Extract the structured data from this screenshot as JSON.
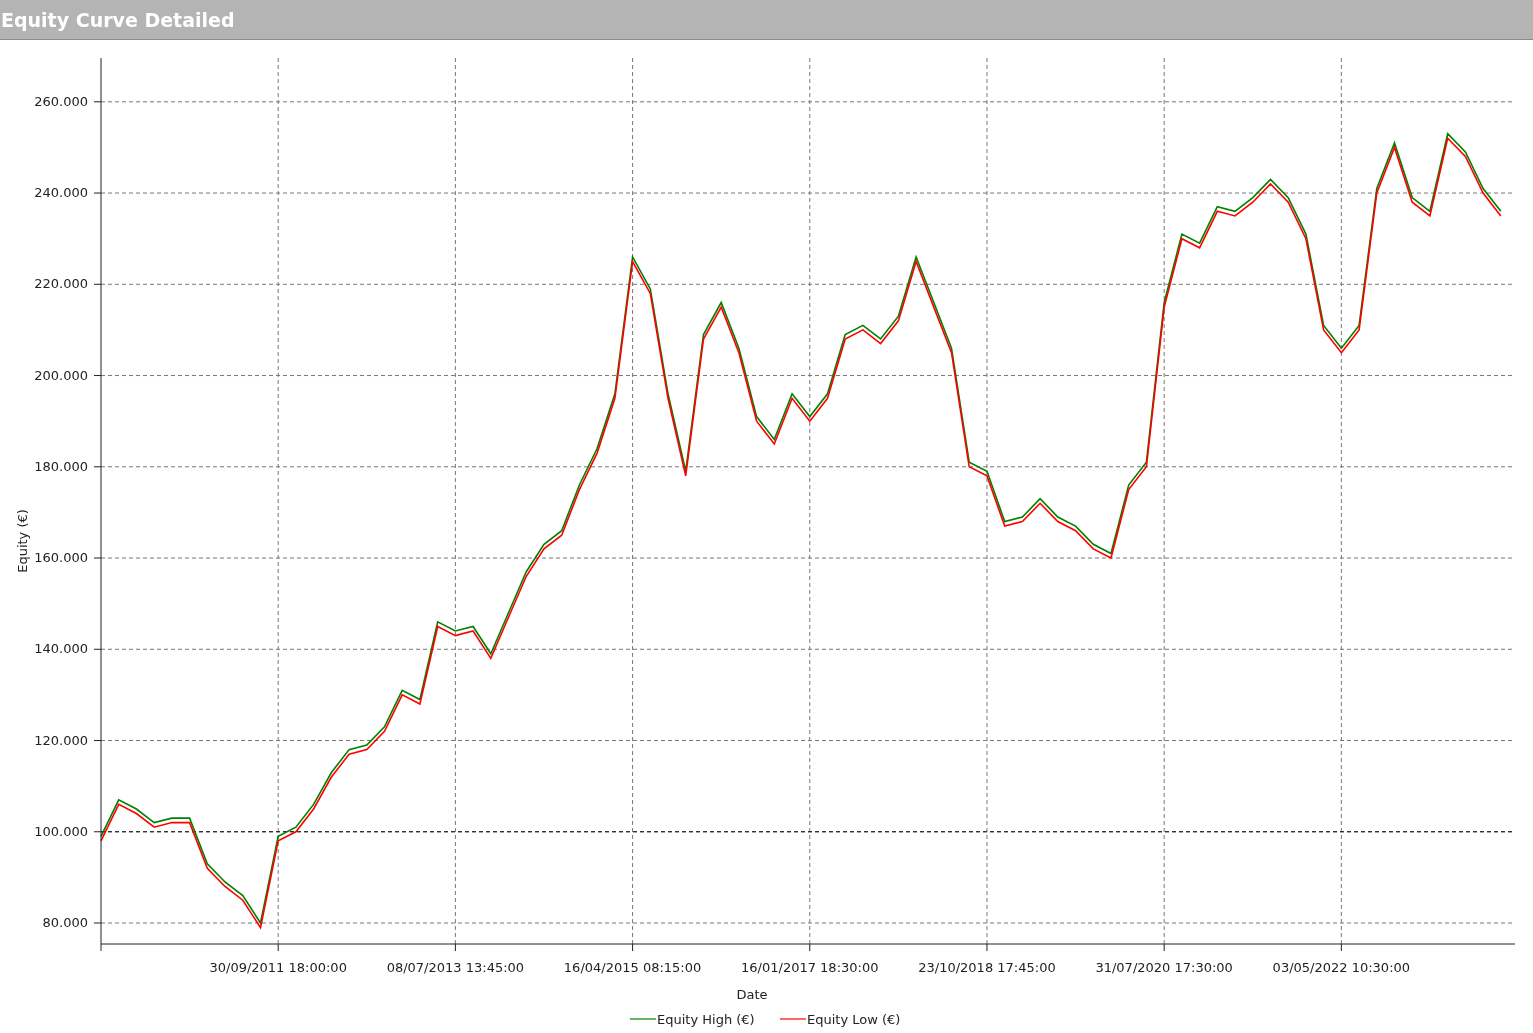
{
  "panel": {
    "title": "Equity Curve Detailed"
  },
  "chart": {
    "chart_data": {
      "type": "line",
      "xlabel": "Date",
      "ylabel": "Equity (€)",
      "categories": [
        null,
        null,
        null,
        null,
        null,
        null,
        null,
        null,
        null,
        null,
        "30/09/2011 18:00:00",
        null,
        null,
        null,
        null,
        null,
        null,
        null,
        null,
        null,
        "08/07/2013 13:45:00",
        null,
        null,
        null,
        null,
        null,
        null,
        null,
        null,
        null,
        "16/04/2015 08:15:00",
        null,
        null,
        null,
        null,
        null,
        null,
        null,
        null,
        null,
        "16/01/2017 18:30:00",
        null,
        null,
        null,
        null,
        null,
        null,
        null,
        null,
        null,
        "23/10/2018 17:45:00",
        null,
        null,
        null,
        null,
        null,
        null,
        null,
        null,
        null,
        "31/07/2020 17:30:00",
        null,
        null,
        null,
        null,
        null,
        null,
        null,
        null,
        null,
        "03/05/2022 10:30:00",
        null,
        null,
        null,
        null,
        null,
        null,
        null,
        null,
        null
      ],
      "series": [
        {
          "name": "Equity High (€)",
          "color": "#008000",
          "values": [
            99000,
            107000,
            105000,
            102000,
            103000,
            103000,
            93000,
            89000,
            86000,
            80000,
            99000,
            101000,
            106000,
            113000,
            118000,
            119000,
            123000,
            131000,
            129000,
            146000,
            144000,
            145000,
            139000,
            148000,
            157000,
            163000,
            166000,
            176000,
            184000,
            196000,
            226000,
            219000,
            196000,
            179000,
            209000,
            216000,
            206000,
            191000,
            186000,
            196000,
            191000,
            196000,
            209000,
            211000,
            208000,
            213000,
            226000,
            216000,
            206000,
            181000,
            179000,
            168000,
            169000,
            173000,
            169000,
            167000,
            163000,
            161000,
            176000,
            181000,
            216000,
            231000,
            229000,
            237000,
            236000,
            239000,
            243000,
            239000,
            231000,
            211000,
            206000,
            211000,
            241000,
            251000,
            239000,
            236000,
            253000,
            249000,
            241000,
            236000
          ]
        },
        {
          "name": "Equity Low (€)",
          "color": "#ff0000",
          "values": [
            98000,
            106000,
            104000,
            101000,
            102000,
            102000,
            92000,
            88000,
            85000,
            79000,
            98000,
            100000,
            105000,
            112000,
            117000,
            118000,
            122000,
            130000,
            128000,
            145000,
            143000,
            144000,
            138000,
            147000,
            156000,
            162000,
            165000,
            175000,
            183000,
            195000,
            225000,
            218000,
            195000,
            178000,
            208000,
            215000,
            205000,
            190000,
            185000,
            195000,
            190000,
            195000,
            208000,
            210000,
            207000,
            212000,
            225000,
            215000,
            205000,
            180000,
            178000,
            167000,
            168000,
            172000,
            168000,
            166000,
            162000,
            160000,
            175000,
            180000,
            215000,
            230000,
            228000,
            236000,
            235000,
            238000,
            242000,
            238000,
            230000,
            210000,
            205000,
            210000,
            240000,
            250000,
            238000,
            235000,
            252000,
            248000,
            240000,
            235000
          ]
        }
      ],
      "ylim": [
        75400,
        269600
      ],
      "grid": true,
      "legend": true,
      "ref_lines": [
        {
          "axis": "y",
          "value": 100000
        }
      ],
      "yticks": [
        {
          "value": 80000,
          "label": "80.000"
        },
        {
          "value": 100000,
          "label": "100.000"
        },
        {
          "value": 120000,
          "label": "120.000"
        },
        {
          "value": 140000,
          "label": "140.000"
        },
        {
          "value": 160000,
          "label": "160.000"
        },
        {
          "value": 180000,
          "label": "180.000"
        },
        {
          "value": 200000,
          "label": "200.000"
        },
        {
          "value": 220000,
          "label": "220.000"
        },
        {
          "value": 240000,
          "label": "240.000"
        },
        {
          "value": 260000,
          "label": "260.000"
        }
      ]
    }
  }
}
